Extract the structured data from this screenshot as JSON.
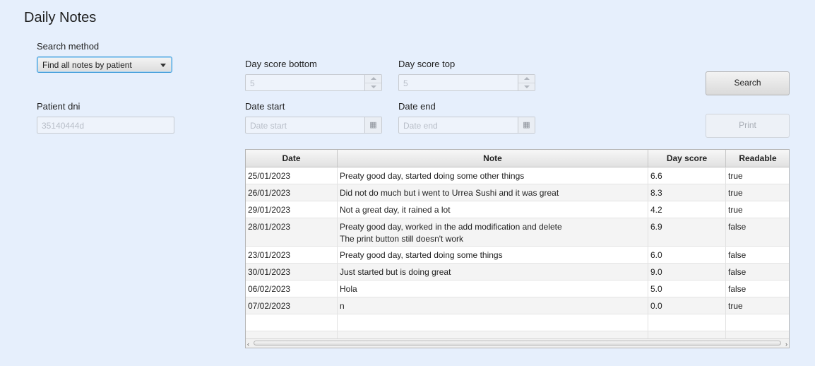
{
  "title": "Daily Notes",
  "search_method": {
    "label": "Search method",
    "selected": "Find all notes by patient"
  },
  "patient_dni": {
    "label": "Patient dni",
    "value": "35140444d"
  },
  "day_score_bottom": {
    "label": "Day score bottom",
    "value": "5"
  },
  "day_score_top": {
    "label": "Day score top",
    "value": "5"
  },
  "date_start": {
    "label": "Date start",
    "placeholder": "Date start"
  },
  "date_end": {
    "label": "Date end",
    "placeholder": "Date end"
  },
  "buttons": {
    "search": "Search",
    "print": "Print"
  },
  "icons": {
    "calendar": "calendar-icon",
    "dropdown": "chevron-down-icon"
  },
  "table": {
    "columns": [
      "Date",
      "Note",
      "Day score",
      "Readable"
    ],
    "rows": [
      {
        "date": "25/01/2023",
        "note": "Preaty good day, started doing some other things",
        "score": "6.6",
        "readable": "true"
      },
      {
        "date": "26/01/2023",
        "note": "Did not do much but i went to Urrea Sushi and it was great",
        "score": "8.3",
        "readable": "true"
      },
      {
        "date": "29/01/2023",
        "note": "Not a great day, it rained a lot",
        "score": "4.2",
        "readable": "true"
      },
      {
        "date": "28/01/2023",
        "note": "Preaty good day, worked in the add modification and delete\nThe print button still doesn't work",
        "score": "6.9",
        "readable": "false"
      },
      {
        "date": "23/01/2023",
        "note": "Preaty good day, started doing some things",
        "score": "6.0",
        "readable": "false"
      },
      {
        "date": "30/01/2023",
        "note": "Just started but is doing great",
        "score": "9.0",
        "readable": "false"
      },
      {
        "date": "06/02/2023",
        "note": "Hola",
        "score": "5.0",
        "readable": "false"
      },
      {
        "date": "07/02/2023",
        "note": "n",
        "score": "0.0",
        "readable": "true"
      }
    ]
  }
}
